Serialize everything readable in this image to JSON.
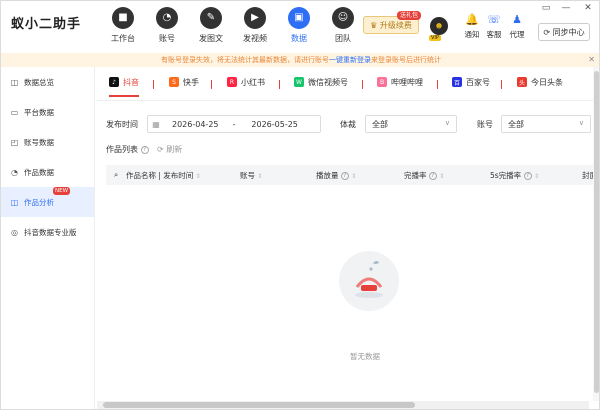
{
  "header": {
    "logo_text": "蚁小二助手",
    "nav": [
      {
        "label": "工作台",
        "icon": "■",
        "icon_name": "dashboard-icon"
      },
      {
        "label": "账号",
        "icon": "◔",
        "icon_name": "account-icon"
      },
      {
        "label": "发图文",
        "icon": "✎",
        "icon_name": "pen-icon"
      },
      {
        "label": "发视频",
        "icon": "▶",
        "icon_name": "play-icon"
      },
      {
        "label": "数据",
        "icon": "▣",
        "icon_name": "data-icon"
      },
      {
        "label": "团队",
        "icon": "☺",
        "icon_name": "team-icon"
      }
    ],
    "active_nav": "数据",
    "upgrade_label": "升级续费",
    "upgrade_badge": "送礼包",
    "avatar_caption": "VIP",
    "tools": [
      {
        "label": "通知",
        "icon": "🔔"
      },
      {
        "label": "客服",
        "icon": "☏"
      },
      {
        "label": "代理",
        "icon": "♟"
      }
    ],
    "sync_label": "同步中心",
    "window_controls": [
      "▭",
      "—",
      "✕"
    ],
    "accent_color": "#2d6ef5"
  },
  "notice": {
    "text_before": "有账号登录失效，将无法统计其最新数据，请进行账号",
    "link": "一键重新登录",
    "text_after": "来登录账号后进行统计"
  },
  "sidebar": {
    "items": [
      {
        "label": "数据总览",
        "icon": "◫"
      },
      {
        "label": "平台数据",
        "icon": "▭"
      },
      {
        "label": "账号数据",
        "icon": "◰"
      },
      {
        "label": "作品数据",
        "icon": "◔"
      },
      {
        "label": "作品分析",
        "icon": "◫",
        "badge": "NEW"
      },
      {
        "label": "抖音数据专业版",
        "icon": "◎"
      }
    ],
    "active": "作品分析"
  },
  "tabs": [
    {
      "label": "抖音",
      "icon": "♪",
      "color": "#111111"
    },
    {
      "label": "快手",
      "icon": "S",
      "color": "#ff6a1a"
    },
    {
      "label": "小红书",
      "icon": "R",
      "color": "#ff2442"
    },
    {
      "label": "微信视频号",
      "icon": "W",
      "color": "#15c46b"
    },
    {
      "label": "哔哩哔哩",
      "icon": "B",
      "color": "#fb7299"
    },
    {
      "label": "百家号",
      "icon": "百",
      "color": "#2932e1"
    },
    {
      "label": "今日头条",
      "icon": "头",
      "color": "#e83a2f"
    }
  ],
  "active_tab": "抖音",
  "filters": {
    "date_label": "发布时间",
    "date_start": "2026-04-25",
    "date_sep": "-",
    "date_end": "2026-05-25",
    "genre_label": "体裁",
    "genre_value": "全部",
    "account_label": "账号",
    "account_value": "全部"
  },
  "list": {
    "title": "作品列表",
    "refresh_label": "刷新",
    "columns": [
      "作品名称 | 发布时间",
      "账号",
      "播放量",
      "完播率",
      "5s完播率",
      "封面"
    ],
    "empty_text": "暂无数据"
  }
}
